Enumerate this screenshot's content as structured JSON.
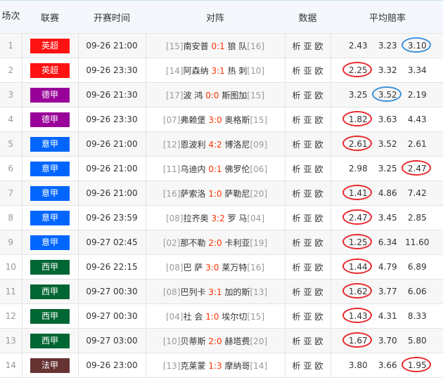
{
  "header": {
    "index": "场次",
    "league": "联赛",
    "time": "开赛时间",
    "match": "对阵",
    "data": "数据",
    "odds": "平均赔率"
  },
  "league_colors": {
    "英超": "#ff1212",
    "德甲": "#990099",
    "意甲": "#0066ff",
    "西甲": "#006633",
    "法甲": "#663333"
  },
  "mark_colors": {
    "red": "#e8262c",
    "blue": "#3a8fdb"
  },
  "data_links": [
    "析",
    "亚",
    "欧"
  ],
  "rows": [
    {
      "index": "1",
      "league": "英超",
      "time": "09-26 21:00",
      "home_rank": "[15]",
      "home": "南安普",
      "score": "0:1",
      "away": "狼 队",
      "away_rank": "[16]",
      "odds": [
        "2.43",
        "3.23",
        "3.10"
      ],
      "marks": [
        null,
        null,
        "blue"
      ]
    },
    {
      "index": "2",
      "league": "英超",
      "time": "09-26 23:30",
      "home_rank": "[14]",
      "home": "阿森纳",
      "score": "3:1",
      "away": "热 刺",
      "away_rank": "[10]",
      "odds": [
        "2.25",
        "3.32",
        "3.34"
      ],
      "marks": [
        "red",
        null,
        null
      ]
    },
    {
      "index": "3",
      "league": "德甲",
      "time": "09-26 21:30",
      "home_rank": "[17]",
      "home": "波 鸿",
      "score": "0:0",
      "away": "斯图加",
      "away_rank": "[15]",
      "odds": [
        "3.25",
        "3.52",
        "2.19"
      ],
      "marks": [
        null,
        "blue",
        null
      ]
    },
    {
      "index": "4",
      "league": "德甲",
      "time": "09-26 23:30",
      "home_rank": "[07]",
      "home": "弗赖堡",
      "score": "3:0",
      "away": "奥格斯",
      "away_rank": "[15]",
      "odds": [
        "1.82",
        "3.63",
        "4.43"
      ],
      "marks": [
        "red",
        null,
        null
      ]
    },
    {
      "index": "5",
      "league": "意甲",
      "time": "09-26 21:00",
      "home_rank": "[12]",
      "home": "恩波利",
      "score": "4:2",
      "away": "博洛尼",
      "away_rank": "[09]",
      "odds": [
        "2.61",
        "3.52",
        "2.61"
      ],
      "marks": [
        "red",
        null,
        null
      ]
    },
    {
      "index": "6",
      "league": "意甲",
      "time": "09-26 21:00",
      "home_rank": "[11]",
      "home": "乌迪内",
      "score": "0:1",
      "away": "佛罗伦",
      "away_rank": "[06]",
      "odds": [
        "2.98",
        "3.25",
        "2.47"
      ],
      "marks": [
        null,
        null,
        "red"
      ]
    },
    {
      "index": "7",
      "league": "意甲",
      "time": "09-26 21:00",
      "home_rank": "[16]",
      "home": "萨索洛",
      "score": "1:0",
      "away": "萨勒尼",
      "away_rank": "[20]",
      "odds": [
        "1.41",
        "4.86",
        "7.42"
      ],
      "marks": [
        "red",
        null,
        null
      ]
    },
    {
      "index": "8",
      "league": "意甲",
      "time": "09-26 23:59",
      "home_rank": "[08]",
      "home": "拉齐奥",
      "score": "3:2",
      "away": "罗 马",
      "away_rank": "[04]",
      "odds": [
        "2.47",
        "3.45",
        "2.85"
      ],
      "marks": [
        "red",
        null,
        null
      ]
    },
    {
      "index": "9",
      "league": "意甲",
      "time": "09-27 02:45",
      "home_rank": "[02]",
      "home": "那不勒",
      "score": "2:0",
      "away": "卡利亚",
      "away_rank": "[19]",
      "odds": [
        "1.25",
        "6.34",
        "11.60"
      ],
      "marks": [
        "red",
        null,
        null
      ]
    },
    {
      "index": "10",
      "league": "西甲",
      "time": "09-26 22:15",
      "home_rank": "[08]",
      "home": "巴 萨",
      "score": "3:0",
      "away": "莱万特",
      "away_rank": "[16]",
      "odds": [
        "1.44",
        "4.79",
        "6.89"
      ],
      "marks": [
        "red",
        null,
        null
      ]
    },
    {
      "index": "11",
      "league": "西甲",
      "time": "09-27 00:30",
      "home_rank": "[08]",
      "home": "巴列卡",
      "score": "3:1",
      "away": "加的斯",
      "away_rank": "[13]",
      "odds": [
        "1.62",
        "3.77",
        "6.06"
      ],
      "marks": [
        "red",
        null,
        null
      ]
    },
    {
      "index": "12",
      "league": "西甲",
      "time": "09-27 00:30",
      "home_rank": "[04]",
      "home": "社 会",
      "score": "1:0",
      "away": "埃尔切",
      "away_rank": "[15]",
      "odds": [
        "1.43",
        "4.31",
        "8.33"
      ],
      "marks": [
        "red",
        null,
        null
      ]
    },
    {
      "index": "13",
      "league": "西甲",
      "time": "09-27 03:00",
      "home_rank": "[10]",
      "home": "贝蒂斯",
      "score": "2:0",
      "away": "赫塔费",
      "away_rank": "[20]",
      "odds": [
        "1.67",
        "3.70",
        "5.80"
      ],
      "marks": [
        "red",
        null,
        null
      ]
    },
    {
      "index": "14",
      "league": "法甲",
      "time": "09-26 23:00",
      "home_rank": "[13]",
      "home": "克莱蒙",
      "score": "1:3",
      "away": "摩纳哥",
      "away_rank": "[14]",
      "odds": [
        "3.80",
        "3.66",
        "1.95"
      ],
      "marks": [
        null,
        null,
        "red"
      ]
    }
  ]
}
